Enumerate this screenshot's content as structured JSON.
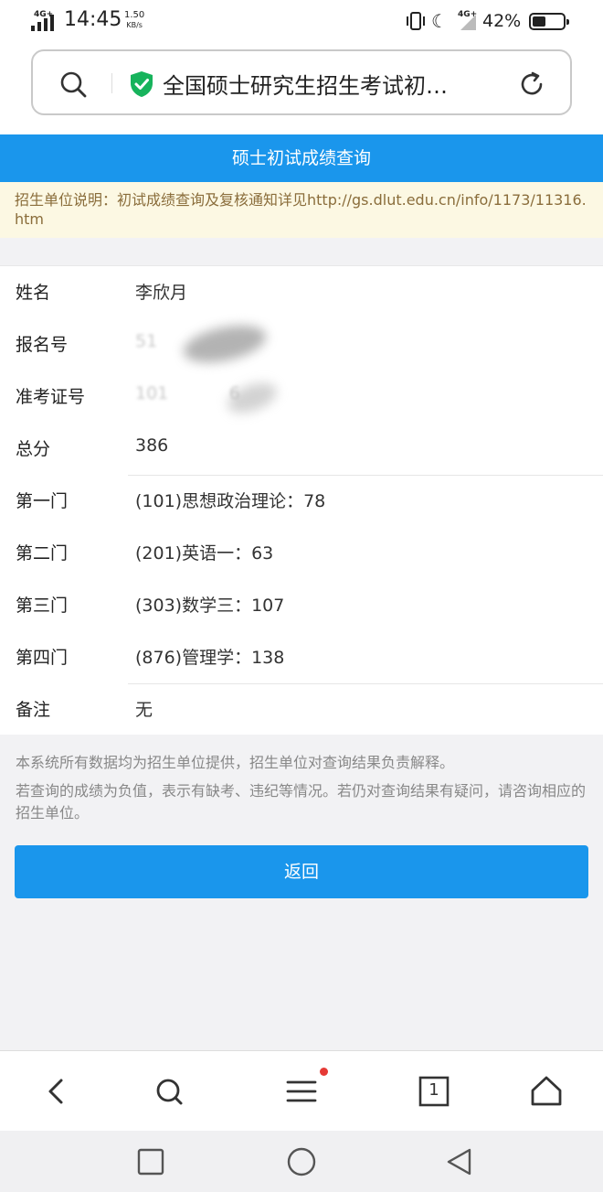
{
  "status_bar": {
    "network_label": "4G+",
    "time": "14:45",
    "speed_value": "1.50",
    "speed_unit": "KB/s",
    "network2_label": "4G+",
    "battery": "42%"
  },
  "address_bar": {
    "url_text": "全国硕士研究生招生考试初…"
  },
  "page": {
    "title": "硕士初试成绩查询",
    "notice": "招生单位说明：初试成绩查询及复核通知详见http://gs.dlut.edu.cn/info/1173/11316.htm"
  },
  "results": {
    "name_label": "姓名",
    "name_value": "李欣月",
    "reg_label": "报名号",
    "reg_value": "51",
    "exam_label": "准考证号",
    "exam_value": "101           6",
    "total_label": "总分",
    "total_value": "386",
    "subject1_label": "第一门",
    "subject1_value": "(101)思想政治理论：78",
    "subject2_label": "第二门",
    "subject2_value": "(201)英语一：63",
    "subject3_label": "第三门",
    "subject3_value": "(303)数学三：107",
    "subject4_label": "第四门",
    "subject4_value": "(876)管理学：138",
    "remark_label": "备注",
    "remark_value": "无"
  },
  "footnote": {
    "line1": "本系统所有数据均为招生单位提供，招生单位对查询结果负责解释。",
    "line2": "若查询的成绩为负值，表示有缺考、违纪等情况。若仍对查询结果有疑问，请咨询相应的招生单位。"
  },
  "back_button": "返回",
  "toolbar": {
    "tab_count": "1"
  },
  "colors": {
    "primary": "#1a96ec",
    "notice_bg": "#fcf8e3",
    "notice_text": "#8a6d3b",
    "secure_green": "#17b35c",
    "badge_red": "#e53935"
  },
  "icons": [
    "signal-icon",
    "vibrate-icon",
    "moon-icon",
    "battery-icon",
    "search-icon",
    "secure-shield-icon",
    "reload-icon",
    "back-arrow-icon",
    "toolbar-search-icon",
    "menu-icon",
    "tabs-icon",
    "home-icon",
    "square-nav-icon",
    "circle-nav-icon",
    "triangle-nav-icon"
  ]
}
